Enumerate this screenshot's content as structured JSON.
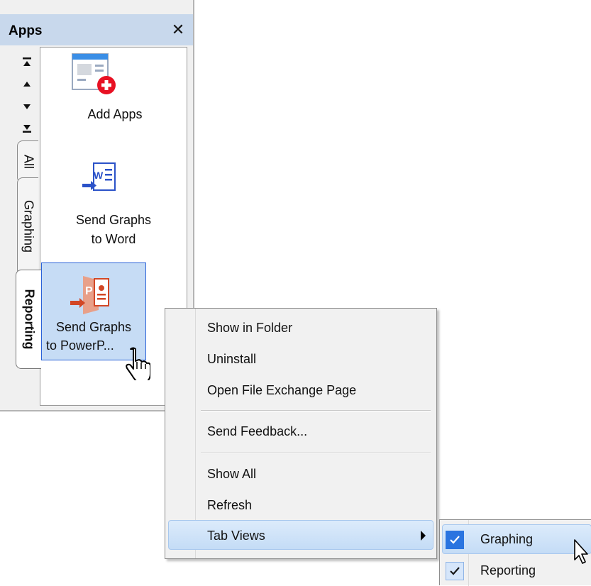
{
  "panel": {
    "title": "Apps",
    "close_glyph": "✕",
    "nav_buttons": [
      "first-icon",
      "previous-icon",
      "next-icon",
      "last-icon"
    ],
    "tabs": [
      {
        "label": "All",
        "active": false
      },
      {
        "label": "Graphing",
        "active": false
      },
      {
        "label": "Reporting",
        "active": true
      }
    ],
    "apps": [
      {
        "icon": "add-apps-icon",
        "line1": "Add Apps",
        "line2": ""
      },
      {
        "icon": "word-icon",
        "line1": "Send Graphs",
        "line2": "to Word"
      },
      {
        "icon": "powerpoint-icon",
        "line1": "Send Graphs",
        "line2": "to PowerP...",
        "selected": true
      }
    ]
  },
  "context_menu": {
    "items": [
      {
        "label": "Show in Folder"
      },
      {
        "label": "Uninstall"
      },
      {
        "label": "Open File Exchange Page"
      },
      {
        "separator": true
      },
      {
        "label": "Send Feedback..."
      },
      {
        "separator": true
      },
      {
        "label": "Show All"
      },
      {
        "label": "Refresh"
      },
      {
        "label": "Tab Views",
        "submenu": true,
        "highlighted": true
      }
    ]
  },
  "submenu": {
    "items": [
      {
        "label": "Graphing",
        "checked": true,
        "highlighted": true
      },
      {
        "label": "Reporting",
        "checked": true
      }
    ]
  },
  "colors": {
    "header_bg": "#c8d8ec",
    "selection": "#c6dcf5",
    "accent_blue": "#2a74e0",
    "word_blue": "#2b52c8",
    "powerpoint_orange": "#d24726",
    "add_red": "#e81123"
  }
}
